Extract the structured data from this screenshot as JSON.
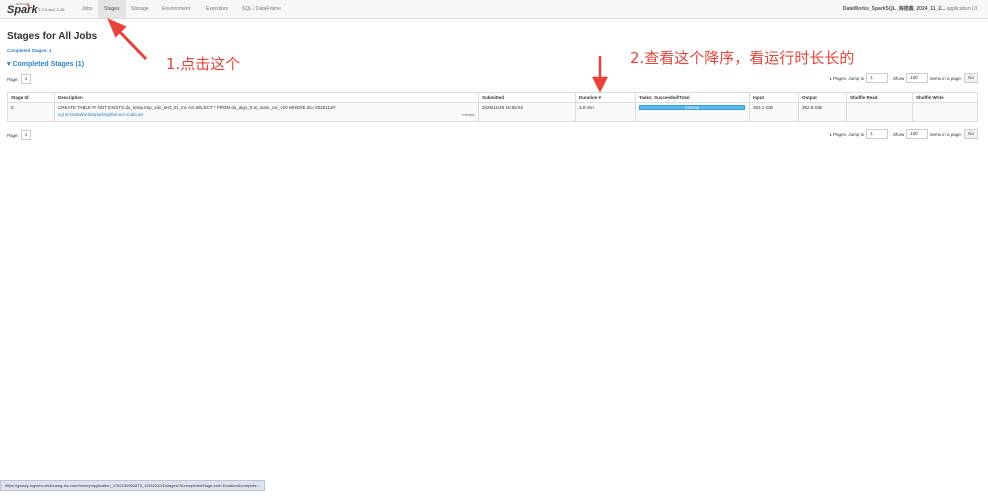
{
  "nav": {
    "logo_word": "Spark",
    "logo_small": "APACHE",
    "version": "3.3.5-dw1.2.45",
    "tabs": [
      "Jobs",
      "Stages",
      "Storage",
      "Environment",
      "Executors",
      "SQL / DataFrame"
    ],
    "app_name": "DataWorks_SparkSQL_海德鑫_2024_11_2...",
    "app_suffix": "application UI"
  },
  "page": {
    "title": "Stages for All Jobs",
    "completed_link": "Completed Stages: 1",
    "section_title": "▾ Completed Stages (1)"
  },
  "pager": {
    "page_label": "Page:",
    "page_value": "1",
    "pages_text": "1 Pages. Jump to",
    "jump_value": "1",
    "show_label": ". Show",
    "show_value": "100",
    "items_text": "items in a page.",
    "go_label": "Go"
  },
  "table": {
    "headers": [
      "Stage Id",
      "Description",
      "Submitted",
      "Duration ▾",
      "Tasks: Succeeded/Total",
      "Input",
      "Output",
      "Shuffle Read",
      "Shuffle Write"
    ],
    "rows": [
      {
        "stage_id": "0",
        "description": "CREATE TABLE IF NOT EXISTS du_temp.tmp_xdx_test_01_mc AS SELECT * FROM du_algo_6.ts_main_cvr_v20 WHERE ds='20251126'",
        "description_sub": "sql at DataWorksSparkSqlRunner.scala:46",
        "details": "+details",
        "submitted": "2025/11/28 10:58:52",
        "duration": "3.9 min",
        "tasks": "335/335",
        "tasks_fraction": 1.0,
        "input": "353.1 GiB",
        "output": "352.9 GiB",
        "shuffle_read": "",
        "shuffle_write": ""
      }
    ]
  },
  "annotations": {
    "one": "1.点击这个",
    "two": "2.查看这个降序，看运行时长长的"
  },
  "status_bar": {
    "url": "https://galaxy-logview.shizhuang-inc.com/history/application_1752190952873_11952210/1/stages/?&completedStage.sort=Duration&complete..."
  },
  "colors": {
    "accent": "#2a82c4",
    "annotation": "#e8433a",
    "progress": "#56b8ef"
  }
}
